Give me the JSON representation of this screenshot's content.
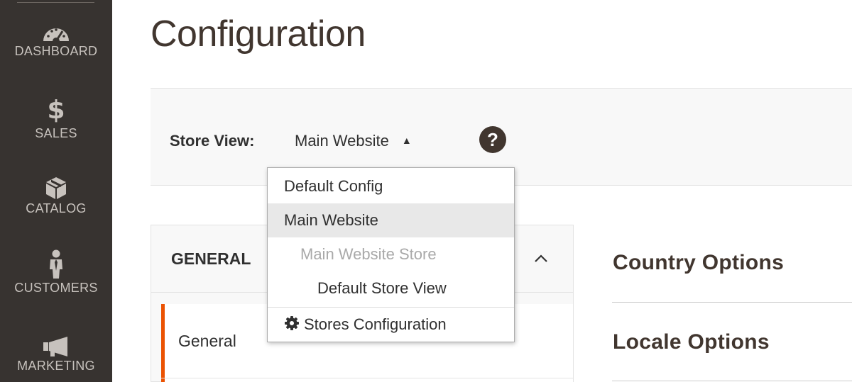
{
  "sidebar": {
    "items": [
      {
        "label": "DASHBOARD",
        "icon": "dashboard-gauge-icon"
      },
      {
        "label": "SALES",
        "icon": "dollar-icon"
      },
      {
        "label": "CATALOG",
        "icon": "box-icon"
      },
      {
        "label": "CUSTOMERS",
        "icon": "person-icon"
      },
      {
        "label": "MARKETING",
        "icon": "megaphone-icon"
      }
    ],
    "dollar_glyph": "$"
  },
  "page": {
    "title": "Configuration"
  },
  "store_switcher": {
    "label": "Store View:",
    "selected": "Main Website",
    "caret": "▲",
    "help": "?",
    "options": [
      {
        "label": "Default Config"
      },
      {
        "label": "Main Website"
      },
      {
        "label": "Main Website Store"
      },
      {
        "label": "Default Store View"
      }
    ],
    "footer_link": "Stores Configuration"
  },
  "config_tabs": {
    "group_title": "GENERAL",
    "items": [
      {
        "label": "General"
      }
    ]
  },
  "sections": [
    {
      "title": "Country Options"
    },
    {
      "title": "Locale Options"
    }
  ],
  "colors": {
    "sidebar_bg": "#373330",
    "accent": "#eb5202",
    "title": "#41362f"
  }
}
